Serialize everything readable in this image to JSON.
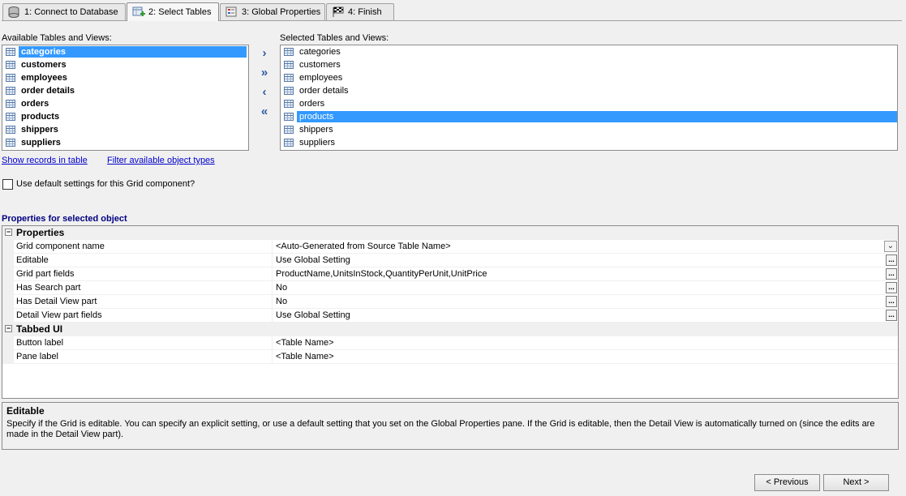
{
  "tabs": [
    {
      "label": "1: Connect to Database",
      "icon": "database-icon"
    },
    {
      "label": "2: Select Tables",
      "icon": "table-add-icon"
    },
    {
      "label": "3: Global Properties",
      "icon": "properties-icon"
    },
    {
      "label": "4: Finish",
      "icon": "checkered-flag-icon"
    }
  ],
  "available": {
    "label": "Available Tables and Views:",
    "items": [
      "categories",
      "customers",
      "employees",
      "order details",
      "orders",
      "products",
      "shippers",
      "suppliers"
    ],
    "selected": "categories"
  },
  "selected_list": {
    "label": "Selected Tables and Views:",
    "items": [
      "categories",
      "customers",
      "employees",
      "order details",
      "orders",
      "products",
      "shippers",
      "suppliers"
    ],
    "selected": "products"
  },
  "arrows": {
    "add": "›",
    "add_all": "»",
    "remove": "‹",
    "remove_all": "«"
  },
  "links": {
    "show_records": "Show records in table",
    "filter_types": "Filter available object types"
  },
  "checkbox": {
    "label": "Use default settings for this Grid component?",
    "checked": false
  },
  "properties_title": "Properties for selected object",
  "property_grid": {
    "categories": [
      {
        "title": "Properties",
        "toggle": "−",
        "rows": [
          {
            "name": "Grid component name",
            "value": "<Auto-Generated from Source Table Name>",
            "button": "dropdown"
          },
          {
            "name": "Editable",
            "value": "Use Global Setting",
            "button": "ellipsis"
          },
          {
            "name": "Grid part fields",
            "value": "ProductName,UnitsInStock,QuantityPerUnit,UnitPrice",
            "button": "ellipsis"
          },
          {
            "name": "Has Search part",
            "value": "No",
            "button": "ellipsis"
          },
          {
            "name": "Has Detail View part",
            "value": "No",
            "button": "ellipsis"
          },
          {
            "name": "Detail View part fields",
            "value": "Use Global Setting",
            "button": "ellipsis"
          }
        ]
      },
      {
        "title": "Tabbed UI",
        "toggle": "−",
        "rows": [
          {
            "name": "Button label",
            "value": "<Table Name>",
            "button": "none"
          },
          {
            "name": "Pane label",
            "value": "<Table Name>",
            "button": "none"
          }
        ]
      }
    ]
  },
  "description": {
    "title": "Editable",
    "body": "Specify if the Grid is editable. You can specify an explicit setting, or use a default setting that you set on the Global Properties pane. If the Grid is editable, then the Detail View is automatically turned on (since the edits are made in the Detail View part)."
  },
  "buttons": {
    "previous": "< Previous",
    "next": "Next >"
  },
  "ellipsis_glyph": "...",
  "dropdown_glyph": "⌄",
  "colors": {
    "selection": "#3399ff",
    "link": "#0000cc",
    "section_title": "#000080",
    "arrow": "#2e5ba8"
  }
}
